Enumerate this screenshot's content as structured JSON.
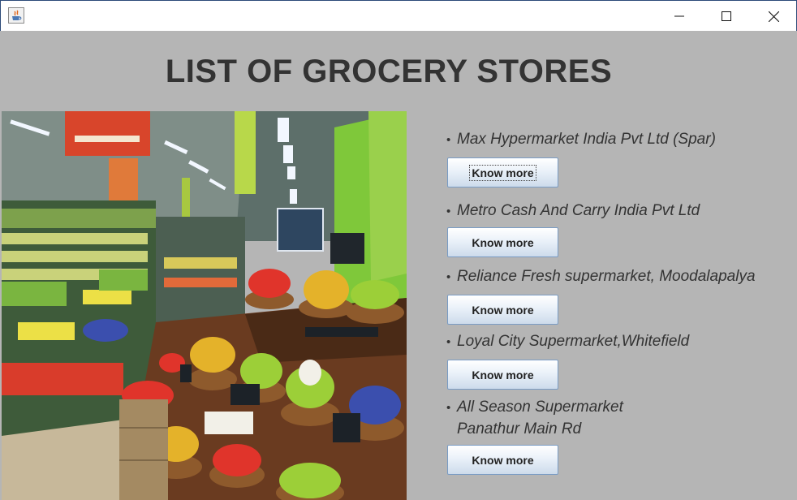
{
  "window": {
    "icons": {
      "app": "java-app-icon",
      "minimize": "minimize-icon",
      "maximize": "maximize-icon",
      "close": "close-icon"
    }
  },
  "main": {
    "title": "LIST OF GROCERY STORES",
    "stores": [
      {
        "name": "Max Hypermarket India Pvt Ltd (Spar)",
        "button": "Know more"
      },
      {
        "name": "Metro Cash And Carry India Pvt Ltd",
        "button": "Know more"
      },
      {
        "name": "Reliance Fresh supermarket, Moodalapalya",
        "button": "Know more"
      },
      {
        "name": "Loyal City Supermarket,Whitefield",
        "button": "Know more"
      },
      {
        "name": "All Season Supermarket",
        "name_line2": "Panathur Main Rd",
        "button": "Know more"
      }
    ],
    "bullet": "•"
  },
  "colors": {
    "background": "#b5b5b5",
    "title_text": "#333333",
    "button_border": "#7a9cc4"
  }
}
